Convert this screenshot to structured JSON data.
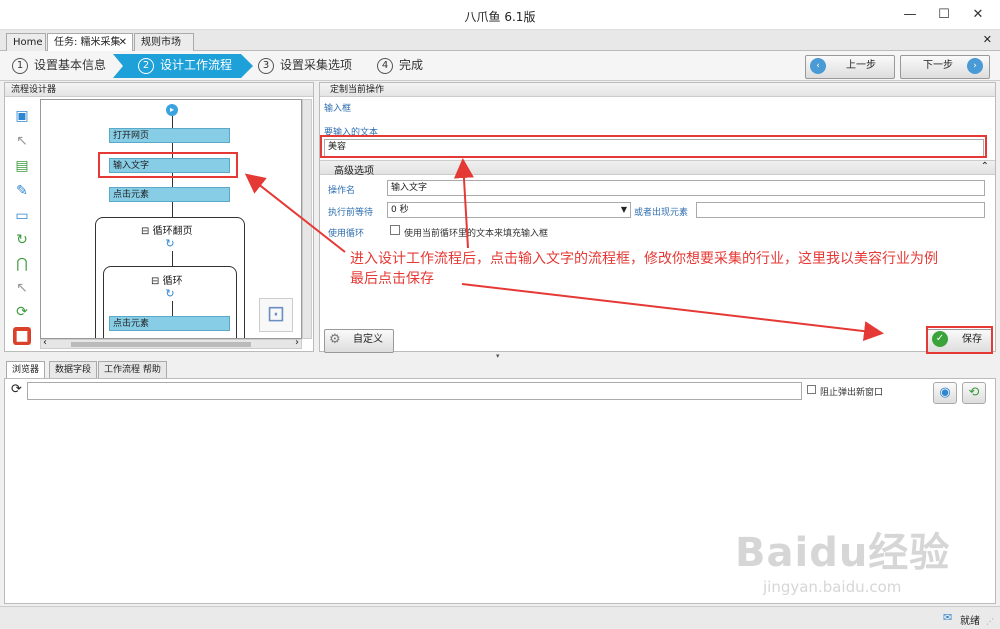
{
  "window": {
    "title": "八爪鱼 6.1版",
    "minimize": "—",
    "maximize": "☐",
    "close": "✕"
  },
  "tabs": [
    {
      "label": "Home"
    },
    {
      "label": "任务: 糯米采集",
      "close": "✕"
    },
    {
      "label": "规则市场"
    }
  ],
  "tabstrip_close": "✕",
  "wizard": {
    "steps": [
      {
        "num": "1",
        "label": "设置基本信息"
      },
      {
        "num": "2",
        "label": "设计工作流程",
        "active": true
      },
      {
        "num": "3",
        "label": "设置采集选项"
      },
      {
        "num": "4",
        "label": "完成"
      }
    ],
    "prev_label": "上一步",
    "next_label": "下一步",
    "prev_icon": "‹",
    "next_icon": "›"
  },
  "flow_designer": {
    "header": "流程设计器",
    "nodes": {
      "open_page": "打开网页",
      "input_text": "输入文字",
      "click_element": "点击元素",
      "loop_paging": "循环翻页",
      "loop": "循环",
      "click_element_2": "点击元素"
    },
    "loop_toggle": "⊟",
    "scroll_left": "‹",
    "scroll_right": "›",
    "tool_icons": [
      "add-page-icon",
      "pointer-icon",
      "extract-data-icon",
      "edit-icon",
      "input-box-icon",
      "loop-icon",
      "branch-icon",
      "cursor-icon",
      "refresh-page-icon",
      "stop-icon"
    ]
  },
  "action_panel": {
    "header": "定制当前操作",
    "type_label": "输入框",
    "text_label": "要输入的文本",
    "text_value": "美容",
    "advanced_header": "高级选项",
    "op_name_label": "操作名",
    "op_name_value": "输入文字",
    "wait_label": "执行前等待",
    "wait_value": "0 秒",
    "or_appear_label": "或者出现元素",
    "or_appear_value": "",
    "use_loop_label": "使用循环",
    "use_loop_checkbox_label": "使用当前循环里的文本来填充输入框",
    "custom_button": "自定义",
    "save_button": "保存",
    "collapse_icon": "⌃"
  },
  "bottom_tabs": [
    {
      "label": "浏览器",
      "active": true
    },
    {
      "label": "数据字段"
    },
    {
      "label": "工作流程 帮助"
    }
  ],
  "browser": {
    "url_value": "",
    "block_popup_label": "阻止弹出新窗口"
  },
  "status": {
    "text": "就绪"
  },
  "annotation": {
    "line1": "进入设计工作流程后，点击输入文字的流程框，修改你想要采集的行业，这里我以美容行业为例",
    "line2": "最后点击保存"
  },
  "watermark": {
    "brand": "Baidu经验",
    "url": "jingyan.baidu.com"
  },
  "colors": {
    "accent": "#1ea0d8",
    "flow_box": "#87cde6",
    "annotation_red": "#e53935"
  }
}
